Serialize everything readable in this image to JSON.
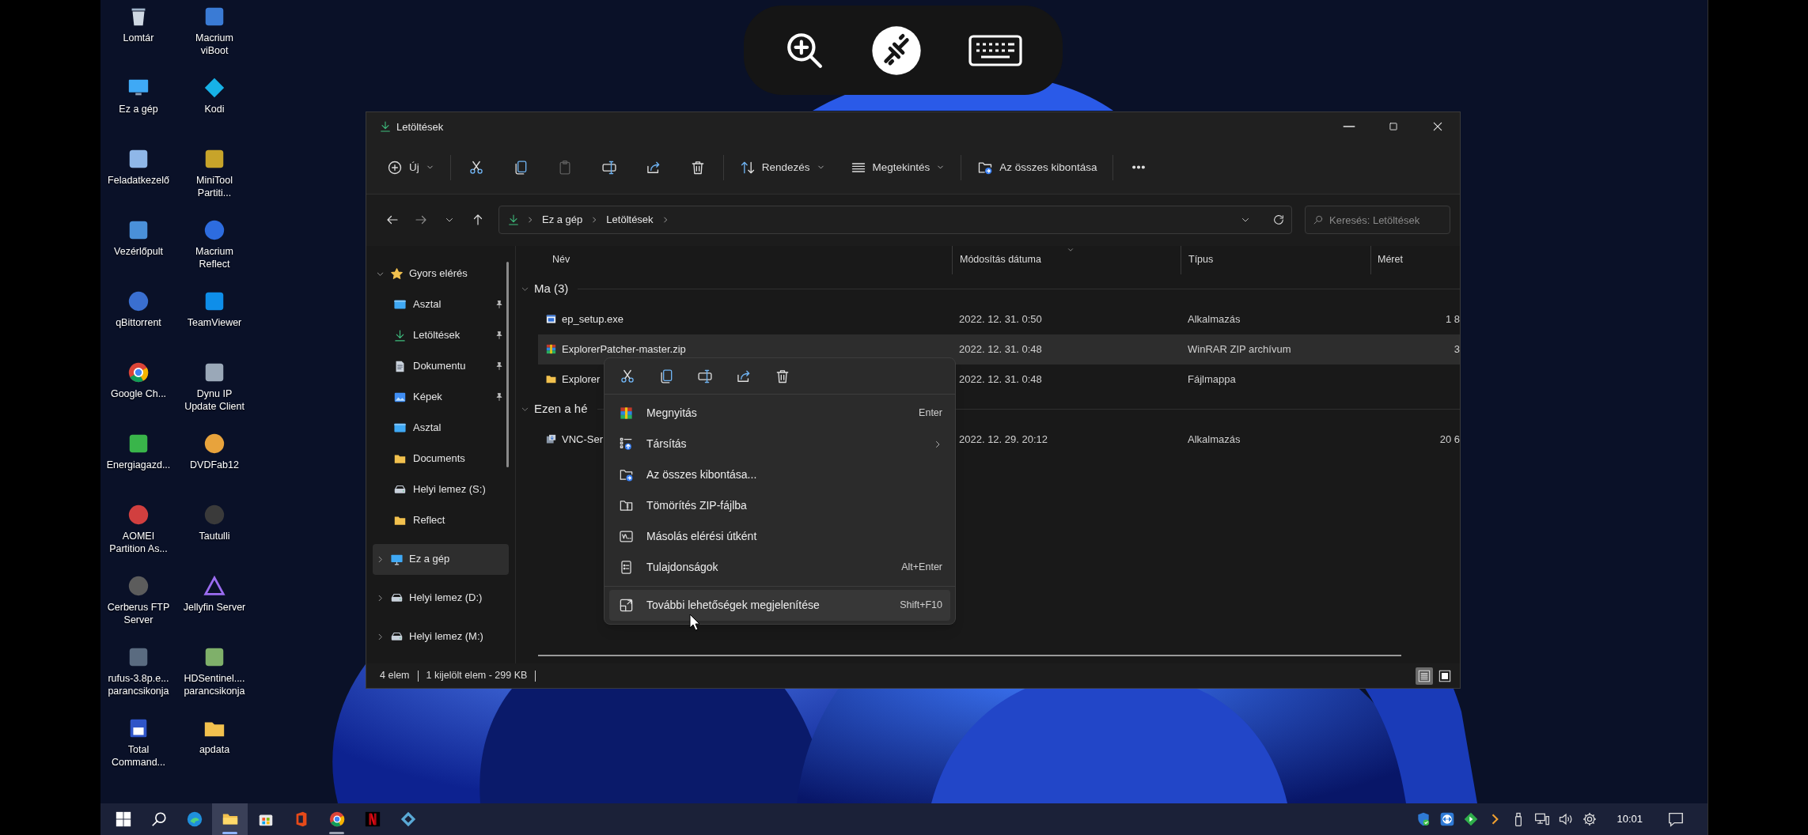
{
  "desktop_icons": [
    {
      "label": "Lomtár",
      "kind": "recycle_bin"
    },
    {
      "label": "Macrium viBoot",
      "kind": "boot_media"
    },
    {
      "label": "Ez a gép",
      "kind": "computer"
    },
    {
      "label": "Kodi",
      "kind": "kodi"
    },
    {
      "label": "Feladatkezelő",
      "kind": "task_manager"
    },
    {
      "label": "MiniTool Partiti...",
      "kind": "partition_tool"
    },
    {
      "label": "Vezérlőpult",
      "kind": "control_panel"
    },
    {
      "label": "Macrium Reflect",
      "kind": "backup"
    },
    {
      "label": "qBittorrent",
      "kind": "torrent"
    },
    {
      "label": "TeamViewer",
      "kind": "remote_support"
    },
    {
      "label": "Google Ch...",
      "kind": "browser"
    },
    {
      "label": "Dynu IP Update Client",
      "kind": "updater"
    },
    {
      "label": "Energiagazd...",
      "kind": "power"
    },
    {
      "label": "DVDFab12",
      "kind": "disc_tool"
    },
    {
      "label": "AOMEI Partition As...",
      "kind": "partition_assistant"
    },
    {
      "label": "Tautulli",
      "kind": "media_stats"
    },
    {
      "label": "Cerberus FTP Server",
      "kind": "ftp_server"
    },
    {
      "label": "Jellyfin Server",
      "kind": "media_server"
    },
    {
      "label": "rufus-3.8p.e... parancsikonja",
      "kind": "usb_tool"
    },
    {
      "label": "HDSentinel.... parancsikonja",
      "kind": "disk_monitor"
    },
    {
      "label": "Total Command...",
      "kind": "file_manager"
    },
    {
      "label": "apdata",
      "kind": "folder"
    }
  ],
  "explorer": {
    "title": "Letöltések",
    "toolbar": [
      {
        "kind": "new",
        "label": "Új",
        "dropdown": true,
        "disabled": false
      },
      {
        "kind": "cut",
        "dropdown": false,
        "disabled": false
      },
      {
        "kind": "copy",
        "dropdown": false,
        "disabled": false
      },
      {
        "kind": "paste",
        "dropdown": false,
        "disabled": true
      },
      {
        "kind": "rename",
        "dropdown": false,
        "disabled": false
      },
      {
        "kind": "share",
        "dropdown": false,
        "disabled": false
      },
      {
        "kind": "delete",
        "dropdown": false,
        "disabled": false
      },
      {
        "kind": "sort",
        "label": "Rendezés",
        "dropdown": true,
        "disabled": false
      },
      {
        "kind": "view",
        "label": "Megtekintés",
        "dropdown": true,
        "disabled": false
      },
      {
        "kind": "extract",
        "label": "Az összes kibontása",
        "dropdown": false,
        "disabled": false
      },
      {
        "kind": "more",
        "dropdown": false,
        "disabled": false
      }
    ],
    "breadcrumbs": [
      "Ez a gép",
      "Letöltések"
    ],
    "search": {
      "placeholder": "Keresés: Letöltések"
    },
    "sidebar": [
      {
        "label": "Gyors elérés",
        "kind": "star",
        "expanded": true,
        "selected": false,
        "children": [
          {
            "label": "Asztal",
            "kind": "desktop",
            "pinned": true,
            "selected": false
          },
          {
            "label": "Letöltések",
            "kind": "download",
            "pinned": true,
            "selected": false
          },
          {
            "label": "Dokumentu",
            "kind": "documents",
            "pinned": true,
            "selected": false
          },
          {
            "label": "Képek",
            "kind": "pictures",
            "pinned": true,
            "selected": false
          },
          {
            "label": "Asztal",
            "kind": "desktop",
            "pinned": false,
            "selected": false
          },
          {
            "label": "Documents",
            "kind": "folder",
            "pinned": false,
            "selected": false
          },
          {
            "label": "Helyi lemez (S:)",
            "kind": "drive",
            "pinned": false,
            "selected": false
          },
          {
            "label": "Reflect",
            "kind": "folder",
            "pinned": false,
            "selected": false
          }
        ]
      },
      {
        "label": "Ez a gép",
        "kind": "computer",
        "expanded": false,
        "selected": true
      },
      {
        "label": "Helyi lemez (D:)",
        "kind": "drive",
        "expanded": false,
        "selected": false
      },
      {
        "label": "Helyi lemez (M:)",
        "kind": "drive",
        "expanded": false,
        "selected": false
      }
    ],
    "columns": [
      {
        "label": "Név",
        "sorted": false
      },
      {
        "label": "Módosítás dátuma",
        "sorted": true
      },
      {
        "label": "Típus",
        "sorted": false
      },
      {
        "label": "Méret",
        "sorted": false
      }
    ],
    "groups": [
      {
        "label": "Ma (3)",
        "expanded": true,
        "rows": [
          {
            "name": "ep_setup.exe",
            "kind": "program",
            "date": "2022. 12. 31. 0:50",
            "type": "Alkalmazás",
            "size": "1 8",
            "selected": false
          },
          {
            "name": "ExplorerPatcher-master.zip",
            "kind": "archive",
            "date": "2022. 12. 31. 0:48",
            "type": "WinRAR ZIP archívum",
            "size": "3",
            "selected": true
          },
          {
            "name": "Explorer",
            "kind": "folder",
            "date": "2022. 12. 31. 0:48",
            "type": "Fájlmappa",
            "selected": false
          }
        ]
      },
      {
        "label": "Ezen a hé",
        "expanded": true,
        "rows": [
          {
            "name": "VNC-Ser",
            "kind": "installer",
            "date": "2022. 12. 29. 20:12",
            "type": "Alkalmazás",
            "size": "20 6",
            "selected": false
          }
        ]
      }
    ],
    "status_bar": {
      "count": "4 elem",
      "selection": "1 kijelölt elem - 299 KB"
    },
    "view_modes": [
      {
        "kind": "details",
        "selected": true
      },
      {
        "kind": "tiles",
        "selected": false
      }
    ]
  },
  "context_menu": {
    "quick_actions": [
      {
        "kind": "cut"
      },
      {
        "kind": "copy"
      },
      {
        "kind": "rename"
      },
      {
        "kind": "share"
      },
      {
        "kind": "delete"
      }
    ],
    "items": [
      {
        "label": "Megnyitás",
        "kind": "archive",
        "shortcut": "Enter",
        "submenu": false,
        "highlighted": false
      },
      {
        "label": "Társítás",
        "kind": "open_with",
        "submenu": true,
        "highlighted": false
      },
      {
        "label": "Az összes kibontása...",
        "kind": "extract",
        "submenu": false,
        "highlighted": false
      },
      {
        "label": "Tömörítés ZIP-fájlba",
        "kind": "zip",
        "submenu": false,
        "highlighted": false
      },
      {
        "label": "Másolás elérési útként",
        "kind": "path",
        "submenu": false,
        "highlighted": false
      },
      {
        "label": "Tulajdonságok",
        "kind": "properties",
        "shortcut": "Alt+Enter",
        "submenu": false,
        "highlighted": false
      },
      {
        "label": "További lehetőségek megjelenítése",
        "kind": "more_options",
        "shortcut": "Shift+F10",
        "submenu": false,
        "highlighted": true
      }
    ]
  },
  "taskbar": {
    "apps": [
      {
        "kind": "start",
        "running": false,
        "active": false
      },
      {
        "kind": "search",
        "running": false,
        "active": false
      },
      {
        "kind": "edge",
        "running": false,
        "active": false
      },
      {
        "kind": "explorer",
        "running": true,
        "active": true
      },
      {
        "kind": "store",
        "running": false,
        "active": false
      },
      {
        "kind": "office",
        "running": false,
        "active": false
      },
      {
        "kind": "chrome",
        "running": true,
        "active": false
      },
      {
        "kind": "netflix",
        "running": false,
        "active": false
      },
      {
        "kind": "kodi",
        "running": false,
        "active": false
      }
    ],
    "tray": [
      {
        "kind": "shield"
      },
      {
        "kind": "remote"
      },
      {
        "kind": "green"
      },
      {
        "kind": "chevron"
      },
      {
        "kind": "usb"
      },
      {
        "kind": "network"
      },
      {
        "kind": "volume"
      },
      {
        "kind": "gear"
      }
    ],
    "clock": "10:01"
  }
}
